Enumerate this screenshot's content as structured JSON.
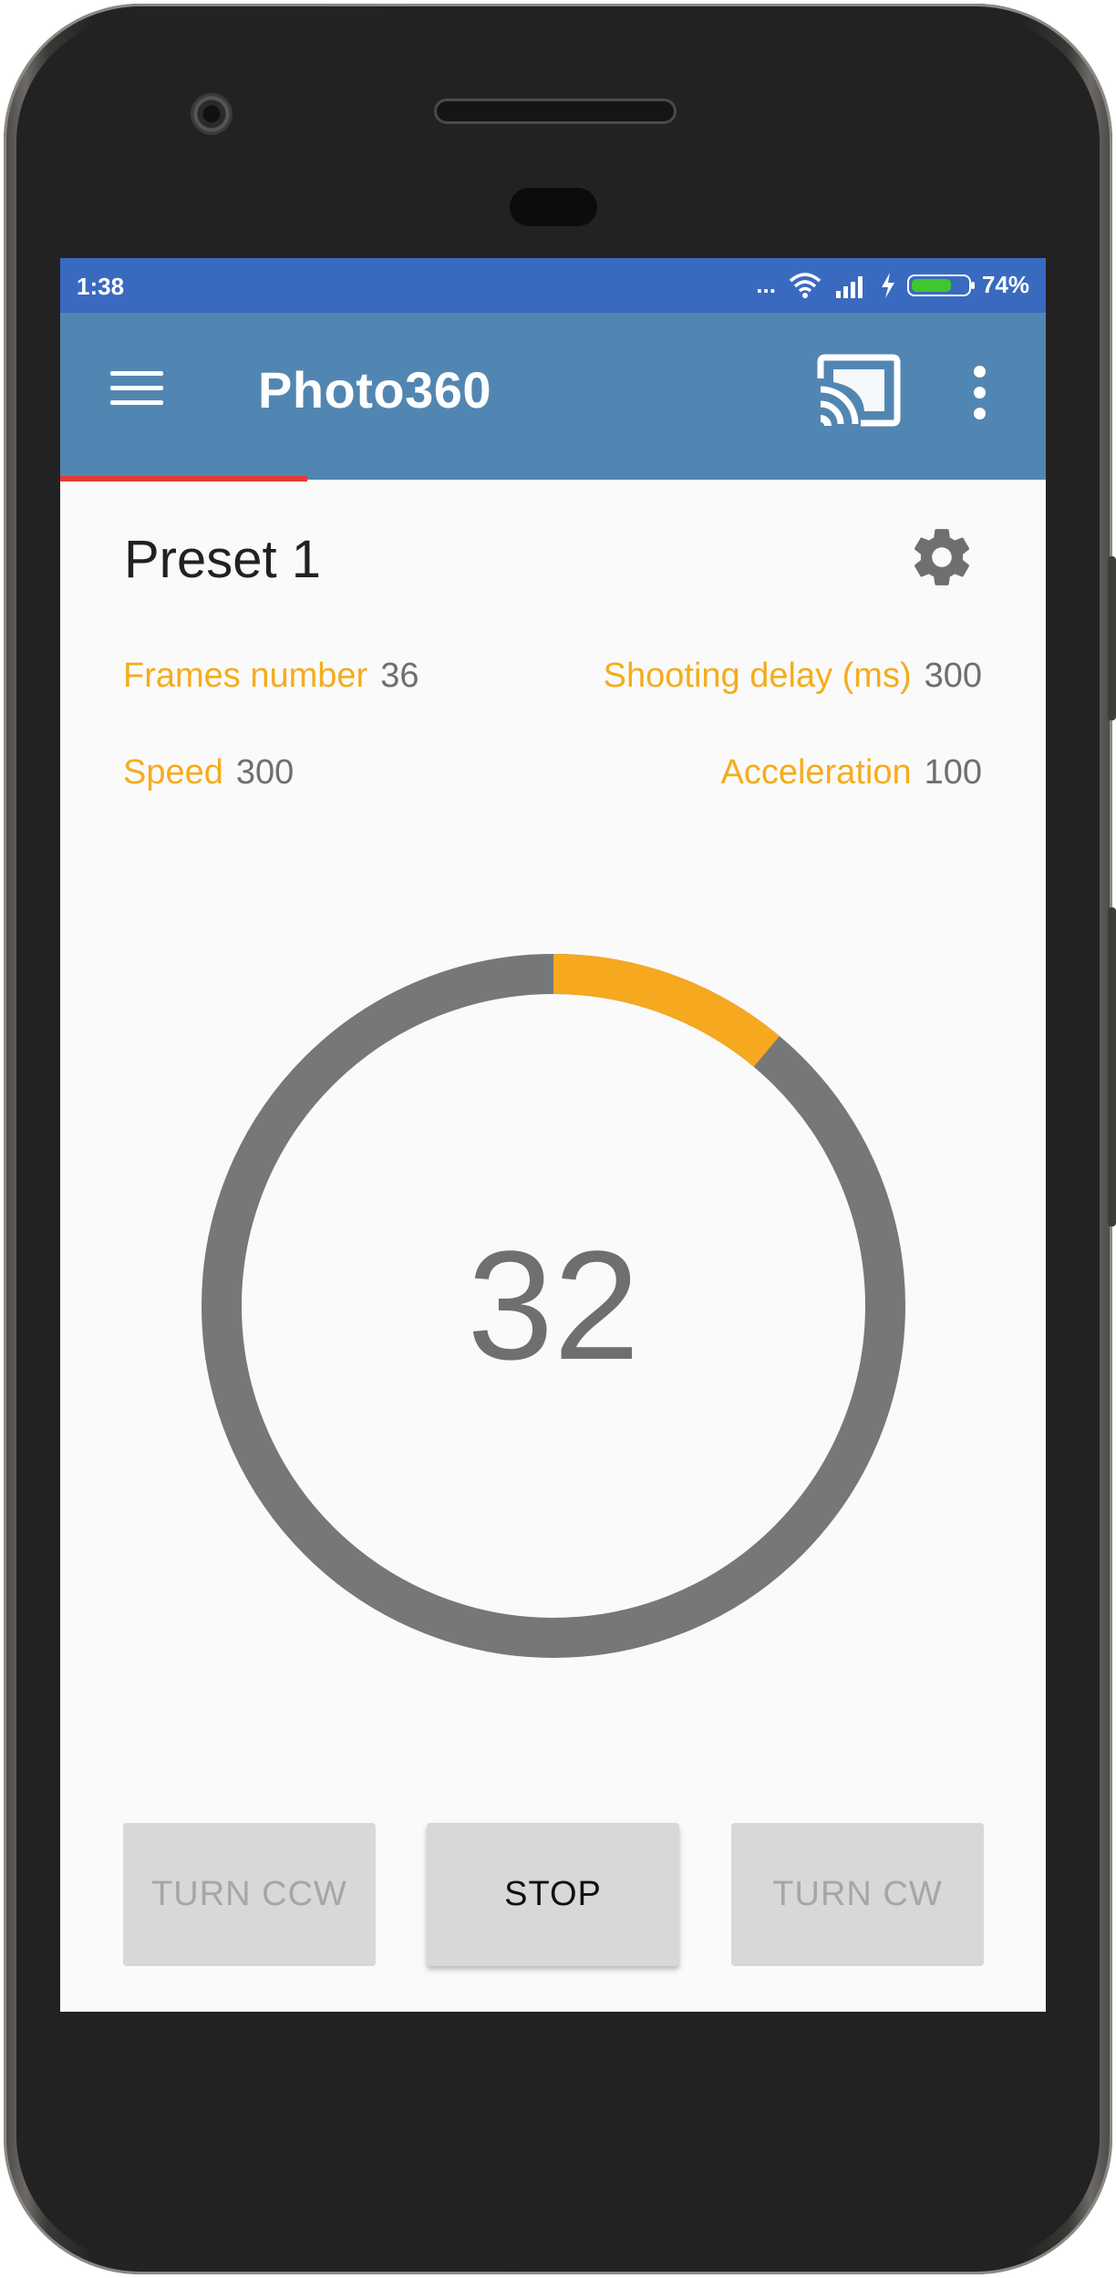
{
  "status_bar": {
    "time": "1:38",
    "signal_dots": "...",
    "battery_percent": "74%",
    "battery_level": 0.74,
    "bar_color": "#3a6ac0"
  },
  "app_bar": {
    "menu_icon": "hamburger-menu-icon",
    "title": "Photo360",
    "cast_icon": "cast-icon",
    "more_icon": "more-vert-icon",
    "bar_color": "#5286b2",
    "indicator_color": "#e53935"
  },
  "preset": {
    "name": "Preset 1",
    "settings_icon": "gear-icon"
  },
  "params": {
    "frames_label": "Frames number",
    "frames_value": "36",
    "delay_label": "Shooting delay (ms)",
    "delay_value": "300",
    "speed_label": "Speed",
    "speed_value": "300",
    "accel_label": "Acceleration",
    "accel_value": "100",
    "label_color": "#f5ac1d"
  },
  "progress": {
    "current_frame": "32",
    "arc_fraction": 0.111,
    "track_color": "#767778",
    "arc_color": "#f6a81e"
  },
  "buttons": {
    "turn_ccw": "TURN CCW",
    "stop": "STOP",
    "turn_cw": "TURN CW"
  }
}
